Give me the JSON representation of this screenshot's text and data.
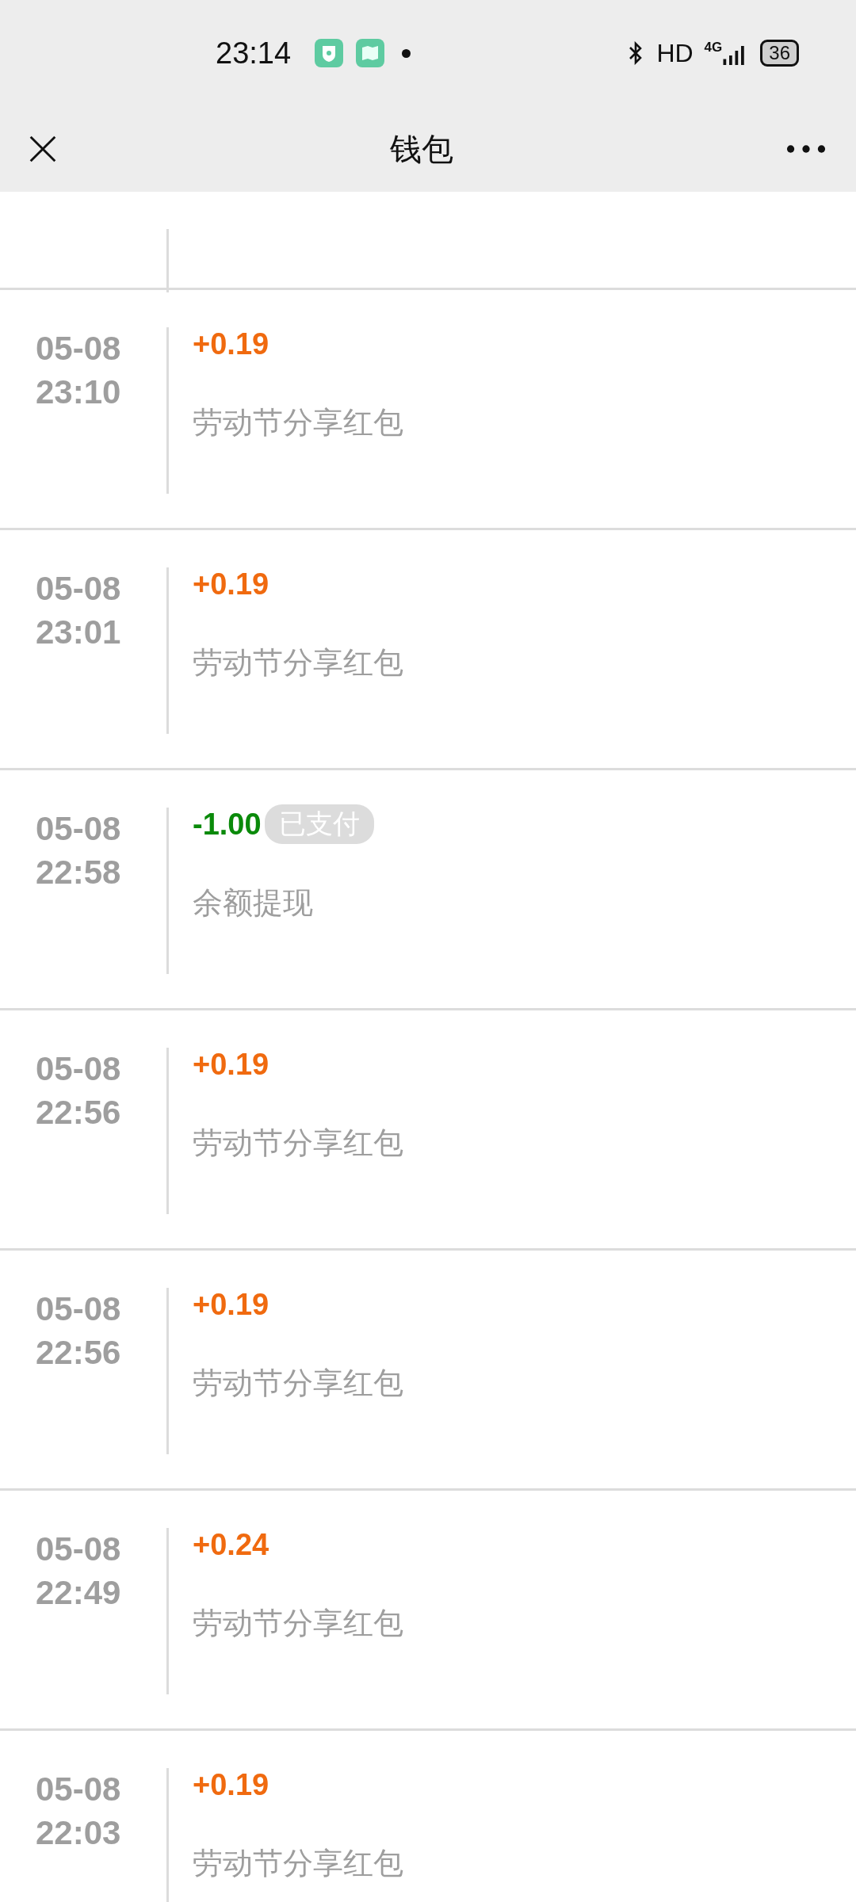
{
  "status_bar": {
    "time": "23:14",
    "network": "HD",
    "signal_type": "4G",
    "battery": "36"
  },
  "header": {
    "title": "钱包"
  },
  "records": [
    {
      "date": "05-08",
      "time": "23:10",
      "amount": "+0.19",
      "kind": "income",
      "description": "劳动节分享红包"
    },
    {
      "date": "05-08",
      "time": "23:01",
      "amount": "+0.19",
      "kind": "income",
      "description": "劳动节分享红包"
    },
    {
      "date": "05-08",
      "time": "22:58",
      "amount": "-1.00",
      "kind": "expense",
      "badge": "已支付",
      "description": "余额提现"
    },
    {
      "date": "05-08",
      "time": "22:56",
      "amount": "+0.19",
      "kind": "income",
      "description": "劳动节分享红包"
    },
    {
      "date": "05-08",
      "time": "22:56",
      "amount": "+0.19",
      "kind": "income",
      "description": "劳动节分享红包"
    },
    {
      "date": "05-08",
      "time": "22:49",
      "amount": "+0.24",
      "kind": "income",
      "description": "劳动节分享红包"
    },
    {
      "date": "05-08",
      "time": "22:03",
      "amount": "+0.19",
      "kind": "income",
      "description": "劳动节分享红包"
    }
  ]
}
